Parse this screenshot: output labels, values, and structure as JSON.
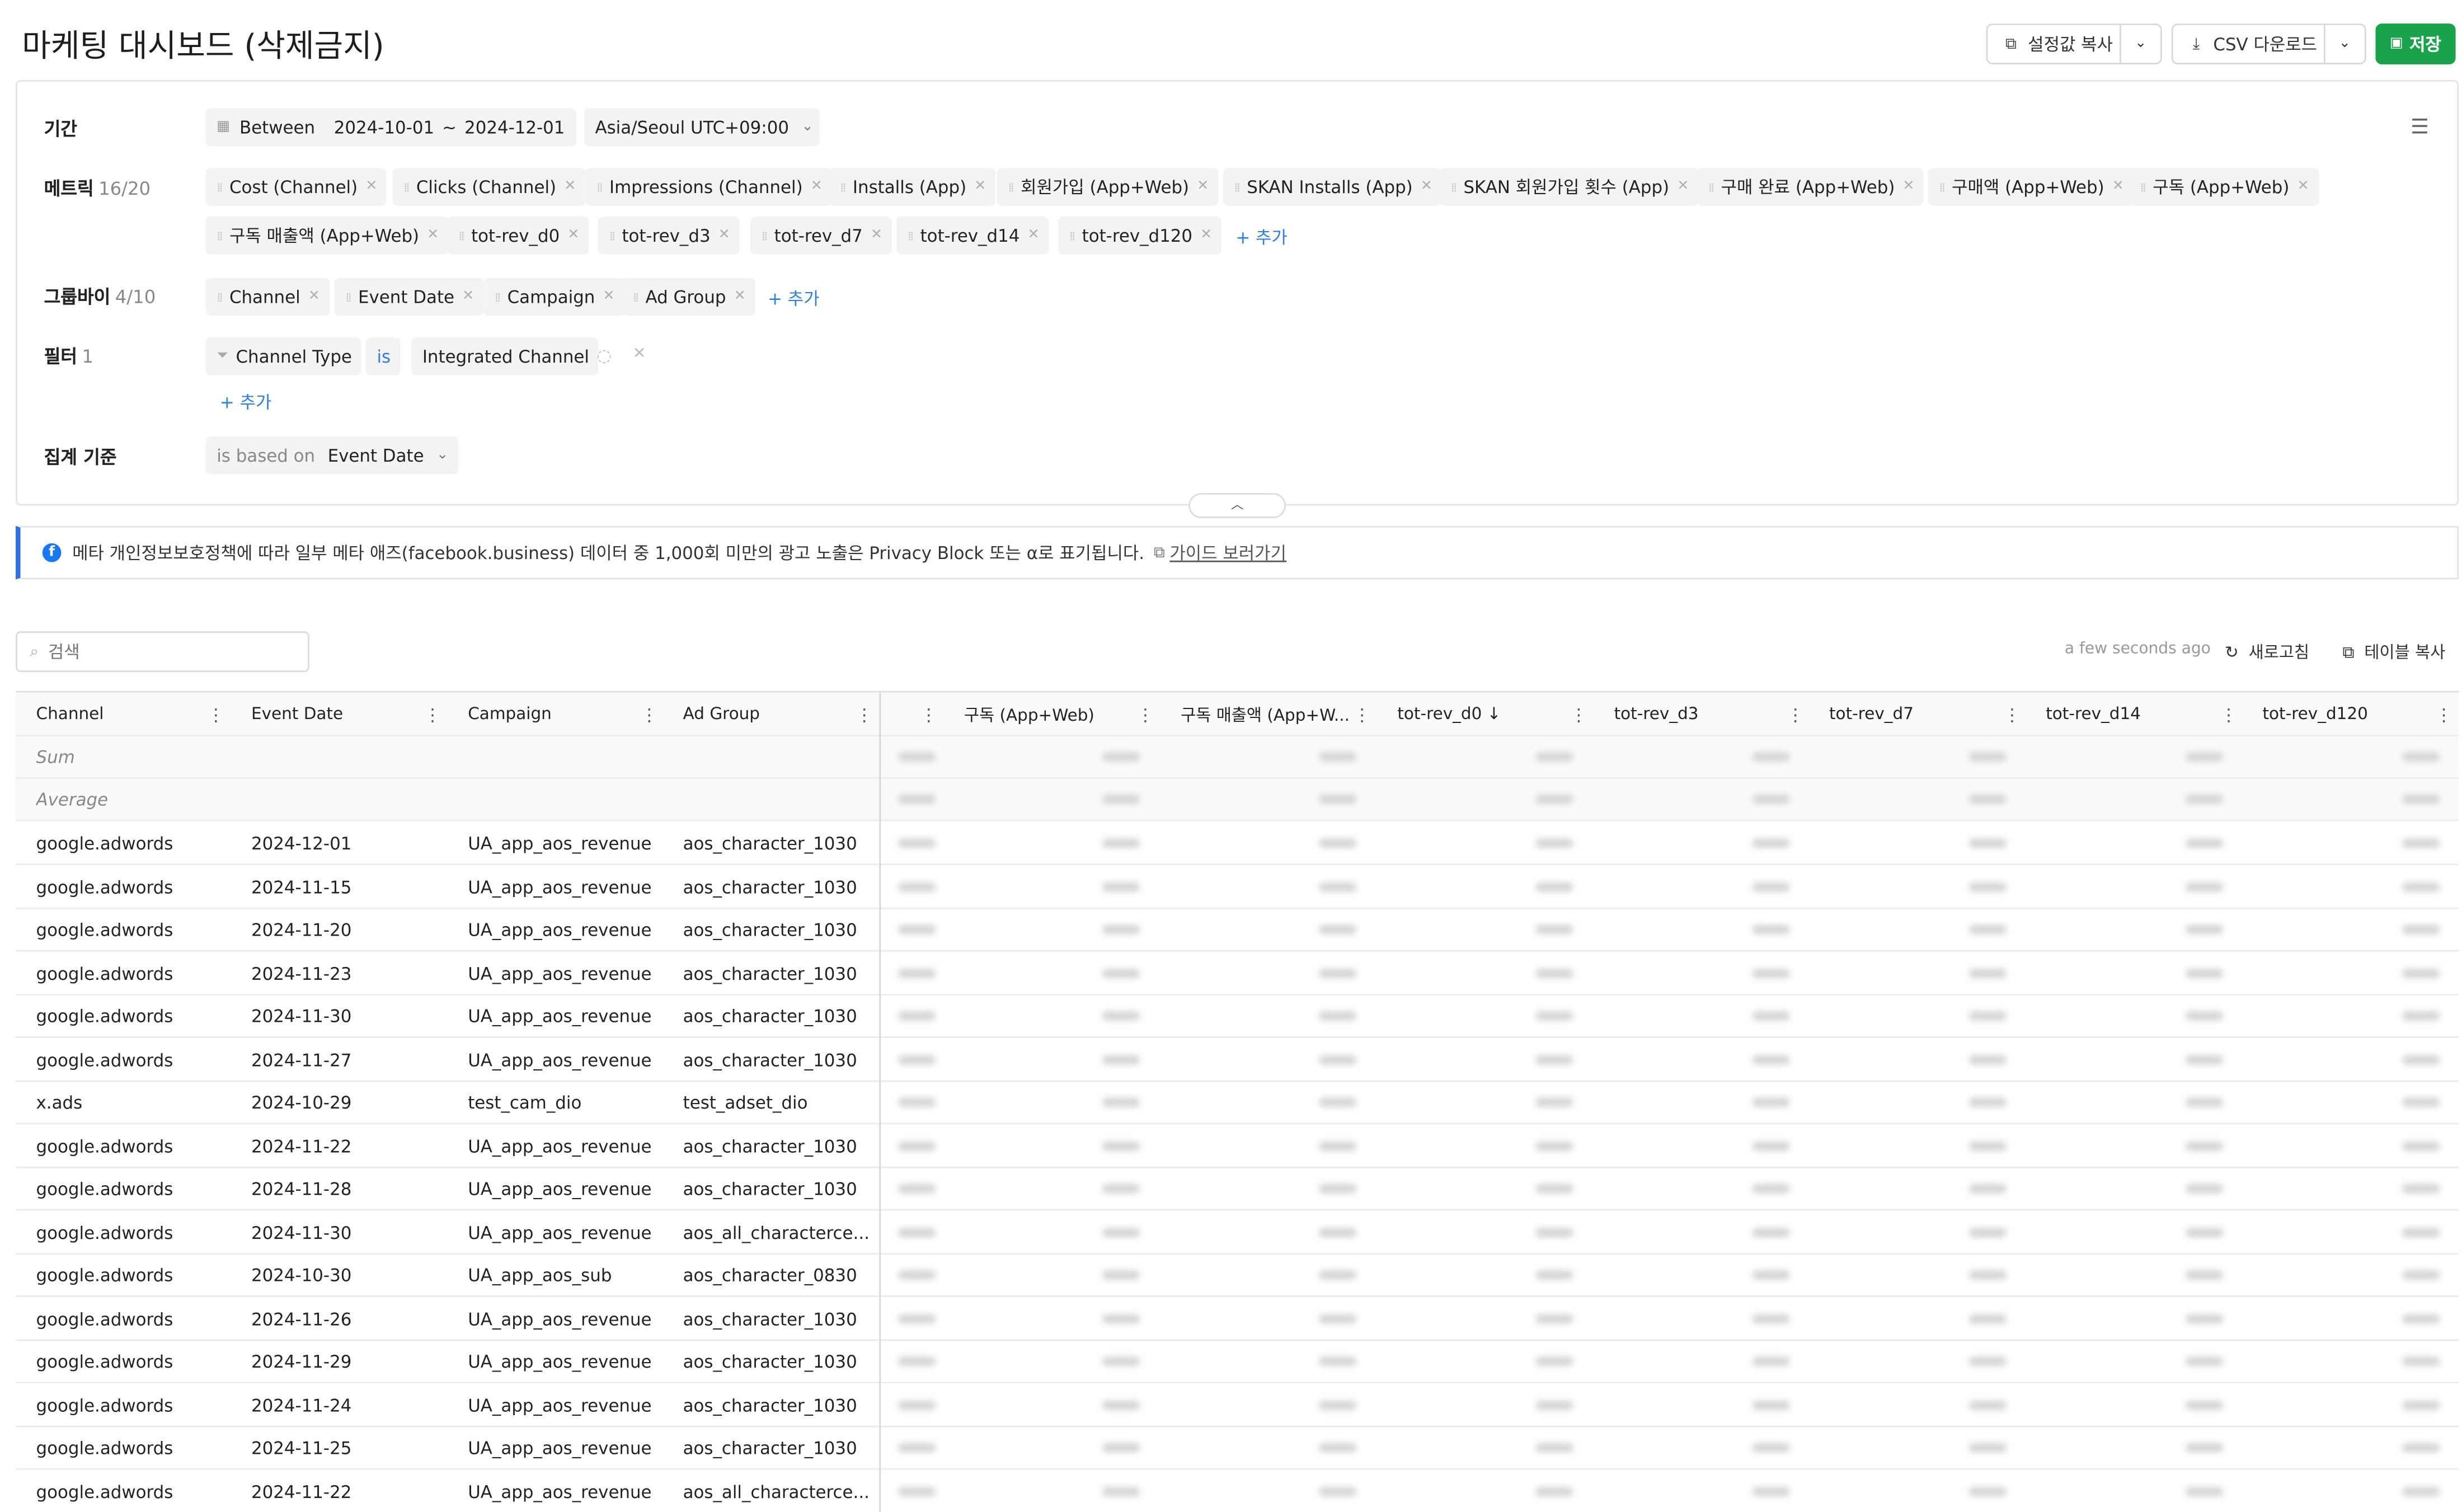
{
  "header": {
    "title": "마케팅 대시보드 (삭제금지)",
    "copy_settings_label": "설정값 복사",
    "csv_download_label": "CSV 다운로드",
    "save_label": "저장"
  },
  "config": {
    "period": {
      "label": "기간",
      "mode": "Between",
      "start": "2024-10-01",
      "separator": "~",
      "end": "2024-12-01",
      "timezone": "Asia/Seoul UTC+09:00"
    },
    "metrics": {
      "label": "메트릭",
      "count": "16/20",
      "items": [
        "Cost (Channel)",
        "Clicks (Channel)",
        "Impressions (Channel)",
        "Installs (App)",
        "회원가입 (App+Web)",
        "SKAN Installs (App)",
        "SKAN 회원가입 횟수 (App)",
        "구매 완료 (App+Web)",
        "구매액 (App+Web)",
        "구독 (App+Web)",
        "구독 매출액 (App+Web)",
        "tot-rev_d0",
        "tot-rev_d3",
        "tot-rev_d7",
        "tot-rev_d14",
        "tot-rev_d120"
      ],
      "add_label": "+ 추가"
    },
    "groupby": {
      "label": "그룹바이",
      "count": "4/10",
      "items": [
        "Channel",
        "Event Date",
        "Campaign",
        "Ad Group"
      ],
      "add_label": "+ 추가"
    },
    "filter": {
      "label": "필터",
      "count": "1",
      "field": "Channel Type",
      "operator": "is",
      "value": "Integrated Channel",
      "add_label": "+ 추가"
    },
    "aggregation": {
      "label": "집계 기준",
      "prefix": "is based on",
      "value": "Event Date"
    }
  },
  "notice": {
    "text": "메타 개인정보보호정책에 따라 일부 메타 애즈(facebook.business) 데이터 중 1,000회 미만의 광고 노출은 Privacy Block 또는 α로 표기됩니다.",
    "guide_link": "가이드 보러가기"
  },
  "toolbar": {
    "search_placeholder": "검색",
    "updated": "a few seconds ago",
    "refresh_label": "새로고침",
    "copy_table_label": "테이블 복사"
  },
  "table": {
    "pinned_columns": [
      "Channel",
      "Event Date",
      "Campaign",
      "Ad Group"
    ],
    "scroll_columns": [
      "구독 (App+Web)",
      "구독 매출액 (App+W...",
      "tot-rev_d0 ↓",
      "tot-rev_d3",
      "tot-rev_d7",
      "tot-rev_d14",
      "tot-rev_d120"
    ],
    "sum_label": "Sum",
    "average_label": "Average",
    "rows": [
      [
        "google.adwords",
        "2024-12-01",
        "UA_app_aos_revenue",
        "aos_character_1030"
      ],
      [
        "google.adwords",
        "2024-11-15",
        "UA_app_aos_revenue",
        "aos_character_1030"
      ],
      [
        "google.adwords",
        "2024-11-20",
        "UA_app_aos_revenue",
        "aos_character_1030"
      ],
      [
        "google.adwords",
        "2024-11-23",
        "UA_app_aos_revenue",
        "aos_character_1030"
      ],
      [
        "google.adwords",
        "2024-11-30",
        "UA_app_aos_revenue",
        "aos_character_1030"
      ],
      [
        "google.adwords",
        "2024-11-27",
        "UA_app_aos_revenue",
        "aos_character_1030"
      ],
      [
        "x.ads",
        "2024-10-29",
        "test_cam_dio",
        "test_adset_dio"
      ],
      [
        "google.adwords",
        "2024-11-22",
        "UA_app_aos_revenue",
        "aos_character_1030"
      ],
      [
        "google.adwords",
        "2024-11-28",
        "UA_app_aos_revenue",
        "aos_character_1030"
      ],
      [
        "google.adwords",
        "2024-11-30",
        "UA_app_aos_revenue",
        "aos_all_characterce..."
      ],
      [
        "google.adwords",
        "2024-10-30",
        "UA_app_aos_sub",
        "aos_character_0830"
      ],
      [
        "google.adwords",
        "2024-11-26",
        "UA_app_aos_revenue",
        "aos_character_1030"
      ],
      [
        "google.adwords",
        "2024-11-29",
        "UA_app_aos_revenue",
        "aos_character_1030"
      ],
      [
        "google.adwords",
        "2024-11-24",
        "UA_app_aos_revenue",
        "aos_character_1030"
      ],
      [
        "google.adwords",
        "2024-11-25",
        "UA_app_aos_revenue",
        "aos_character_1030"
      ],
      [
        "google.adwords",
        "2024-11-22",
        "UA_app_aos_revenue",
        "aos_all_characterce..."
      ]
    ]
  },
  "colors": {
    "accent": "#2f7fe0",
    "save_green": "#1aa34a",
    "notice_border": "#2f6fe0"
  }
}
